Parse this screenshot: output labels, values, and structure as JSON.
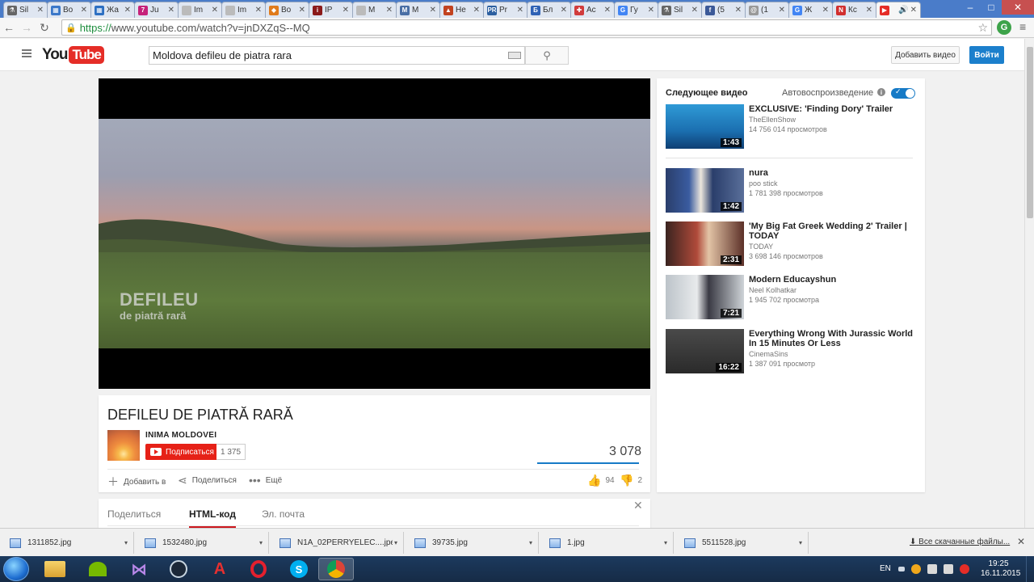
{
  "browser": {
    "tabs": [
      {
        "label": "Sil",
        "color": "#666666",
        "glyph": "⚗"
      },
      {
        "label": "Во",
        "color": "#3b78c9",
        "glyph": "▦"
      },
      {
        "label": "Жа",
        "color": "#2c6fc2",
        "glyph": "▦"
      },
      {
        "label": "Ju",
        "color": "#c6227a",
        "glyph": "7"
      },
      {
        "label": "Im",
        "color": "#bbbbbb",
        "glyph": ""
      },
      {
        "label": "Im",
        "color": "#bbbbbb",
        "glyph": ""
      },
      {
        "label": "Во",
        "color": "#e07b1c",
        "glyph": "◆"
      },
      {
        "label": "IP",
        "color": "#8b1a1a",
        "glyph": "i"
      },
      {
        "label": "М",
        "color": "#bbbbbb",
        "glyph": ""
      },
      {
        "label": "M",
        "color": "#4a6fa5",
        "glyph": "M"
      },
      {
        "label": "Не",
        "color": "#c2421f",
        "glyph": "▲"
      },
      {
        "label": "Pr",
        "color": "#2c5fa0",
        "glyph": "PR"
      },
      {
        "label": "Бл",
        "color": "#2f62b5",
        "glyph": "Б"
      },
      {
        "label": "Ас",
        "color": "#d13c3c",
        "glyph": "✚"
      },
      {
        "label": "Гу",
        "color": "#4285f4",
        "glyph": "G"
      },
      {
        "label": "Sil",
        "color": "#666666",
        "glyph": "⚗"
      },
      {
        "label": "(5",
        "color": "#3b5998",
        "glyph": "f"
      },
      {
        "label": "(1",
        "color": "#999999",
        "glyph": "@"
      },
      {
        "label": "Ж",
        "color": "#4285f4",
        "glyph": "G"
      },
      {
        "label": "Кс",
        "color": "#d12f2f",
        "glyph": "N"
      },
      {
        "label": "",
        "color": "#e52d27",
        "glyph": "▶",
        "active": true
      }
    ],
    "url_https": "https://",
    "url_rest": "www.youtube.com/watch?v=jnDXZqS--MQ"
  },
  "masthead": {
    "logo_you": "You",
    "logo_tube": "Tube",
    "search_value": "Moldova defileu de piatra rara",
    "upload_label": "Добавить видео",
    "signin_label": "Войти"
  },
  "player": {
    "overlay_title": "DEFILEU",
    "overlay_subtitle": "de piatră rară"
  },
  "video": {
    "title": "DEFILEU DE PIATRĂ RARĂ",
    "channel": "INIMA MOLDOVEI",
    "subscribe_label": "Подписаться",
    "subscriber_count": "1 375",
    "views": "3 078",
    "actions": {
      "add_to": "Добавить в",
      "share": "Поделиться",
      "more": "Ещё"
    },
    "likes": "94",
    "dislikes": "2"
  },
  "share_panel": {
    "tabs": [
      "Поделиться",
      "HTML-код",
      "Эл. почта"
    ],
    "active_tab": 1
  },
  "sidebar": {
    "up_next": "Следующее видео",
    "autoplay": "Автовоспроизведение",
    "autoplay_on": true,
    "videos": [
      {
        "title": "EXCLUSIVE: 'Finding Dory' Trailer",
        "channel": "TheEllenShow",
        "views": "14 756 014 просмотров",
        "duration": "1:43",
        "thumb": "dory"
      },
      {
        "title": "nura",
        "channel": "poo stick",
        "views": "1 781 398 просмотров",
        "duration": "1:42",
        "thumb": "news"
      },
      {
        "title": "'My Big Fat Greek Wedding 2' Trailer | TODAY",
        "channel": "TODAY",
        "views": "3 698 146 просмотров",
        "duration": "2:31",
        "thumb": "today"
      },
      {
        "title": "Modern Educayshun",
        "channel": "Neel Kolhatkar",
        "views": "1 945 702 просмотра",
        "duration": "7:21",
        "thumb": "class"
      },
      {
        "title": "Everything Wrong With Jurassic World In 15 Minutes Or Less",
        "channel": "CinemaSins",
        "views": "1 387 091 просмотр",
        "duration": "16:22",
        "thumb": "jurassic"
      }
    ]
  },
  "downloads": {
    "items": [
      "1311852.jpg",
      "1532480.jpg",
      "N1A_02PERRYELEC....jpeg",
      "39735.jpg",
      "1.jpg",
      "5511528.jpg"
    ],
    "show_all": "Все скачанные файлы..."
  },
  "taskbar": {
    "lang": "EN",
    "time": "19:25",
    "date": "16.11.2015"
  }
}
